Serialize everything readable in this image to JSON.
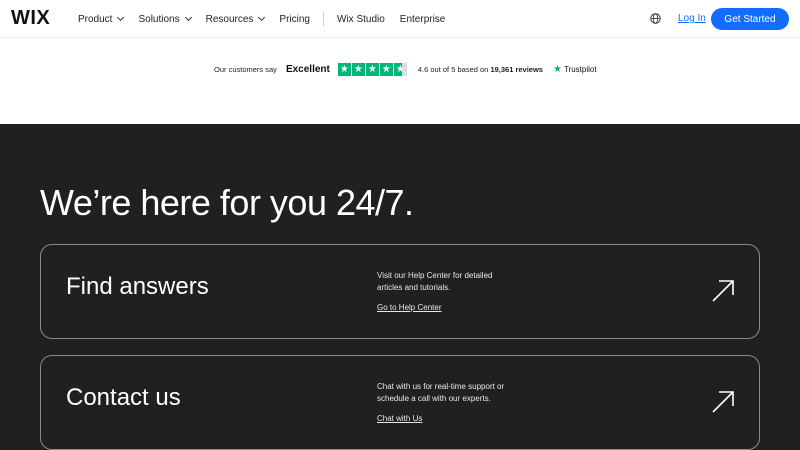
{
  "header": {
    "logo": "WIX",
    "nav": [
      {
        "label": "Product",
        "has_dropdown": true
      },
      {
        "label": "Solutions",
        "has_dropdown": true
      },
      {
        "label": "Resources",
        "has_dropdown": true
      },
      {
        "label": "Pricing",
        "has_dropdown": false
      },
      {
        "label": "Wix Studio",
        "has_dropdown": false
      },
      {
        "label": "Enterprise",
        "has_dropdown": false
      }
    ],
    "language_icon": "globe-icon",
    "login_label": "Log In",
    "cta_label": "Get Started",
    "accent_color": "#116dff"
  },
  "trustpilot": {
    "customers_say": "Our customers say",
    "rating_word": "Excellent",
    "stars_icon": "star-icon",
    "rating": 4.6,
    "rating_max": 5,
    "score_prefix": "4.6 out of 5 based on",
    "review_count": "19,361 reviews",
    "brand": "Trustpilot",
    "brand_color": "#00b67a"
  },
  "support": {
    "headline": "We’re here for you 24/7.",
    "cards": [
      {
        "title": "Find answers",
        "description": "Visit our Help Center for detailed articles and tutorials.",
        "link": "Go to Help Center",
        "icon": "arrow-up-right-icon"
      },
      {
        "title": "Contact us",
        "description": "Chat with us for real-time support or schedule a call with our experts.",
        "link": "Chat with Us",
        "icon": "arrow-up-right-icon"
      }
    ],
    "background_color": "#202023"
  }
}
